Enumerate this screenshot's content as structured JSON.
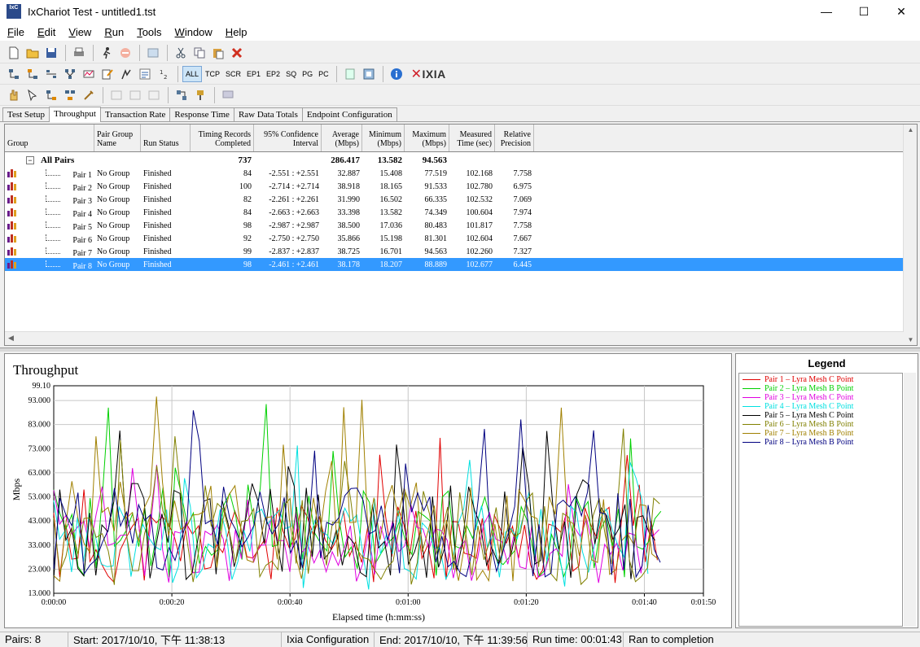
{
  "window": {
    "title": "IxChariot Test - untitled1.tst",
    "icon_text": "IxC",
    "minimize": "—",
    "maximize": "☐",
    "close": "✕"
  },
  "menu": [
    {
      "pre": "",
      "u": "F",
      "post": "ile"
    },
    {
      "pre": "",
      "u": "E",
      "post": "dit"
    },
    {
      "pre": "",
      "u": "V",
      "post": "iew"
    },
    {
      "pre": "",
      "u": "R",
      "post": "un"
    },
    {
      "pre": "",
      "u": "T",
      "post": "ools"
    },
    {
      "pre": "",
      "u": "W",
      "post": "indow"
    },
    {
      "pre": "",
      "u": "H",
      "post": "elp"
    }
  ],
  "toolbar2_text": [
    "ALL",
    "TCP",
    "SCR",
    "EP1",
    "EP2",
    "SQ",
    "PG",
    "PC"
  ],
  "ixia_logo": "IXIA",
  "tabs": [
    "Test Setup",
    "Throughput",
    "Transaction Rate",
    "Response Time",
    "Raw Data Totals",
    "Endpoint Configuration"
  ],
  "active_tab": "Throughput",
  "grid": {
    "headers": [
      [
        "",
        "Group"
      ],
      [
        "Pair Group",
        "Name"
      ],
      [
        "",
        "Run Status"
      ],
      [
        "Timing Records",
        "Completed"
      ],
      [
        "95% Confidence",
        "Interval"
      ],
      [
        "Average",
        "(Mbps)"
      ],
      [
        "Minimum",
        "(Mbps)"
      ],
      [
        "Maximum",
        "(Mbps)"
      ],
      [
        "Measured",
        "Time (sec)"
      ],
      [
        "Relative",
        "Precision"
      ]
    ],
    "total": {
      "label": "All Pairs",
      "expander": "−",
      "records": "737",
      "average": "286.417",
      "minimum": "13.582",
      "maximum": "94.563"
    },
    "rows": [
      {
        "pair": "Pair 1",
        "group": "No Group",
        "status": "Finished",
        "records": "84",
        "ci": "-2.551 : +2.551",
        "avg": "32.887",
        "min": "15.408",
        "max": "77.519",
        "time": "102.168",
        "prec": "7.758"
      },
      {
        "pair": "Pair 2",
        "group": "No Group",
        "status": "Finished",
        "records": "100",
        "ci": "-2.714 : +2.714",
        "avg": "38.918",
        "min": "18.165",
        "max": "91.533",
        "time": "102.780",
        "prec": "6.975"
      },
      {
        "pair": "Pair 3",
        "group": "No Group",
        "status": "Finished",
        "records": "82",
        "ci": "-2.261 : +2.261",
        "avg": "31.990",
        "min": "16.502",
        "max": "66.335",
        "time": "102.532",
        "prec": "7.069"
      },
      {
        "pair": "Pair 4",
        "group": "No Group",
        "status": "Finished",
        "records": "84",
        "ci": "-2.663 : +2.663",
        "avg": "33.398",
        "min": "13.582",
        "max": "74.349",
        "time": "100.604",
        "prec": "7.974"
      },
      {
        "pair": "Pair 5",
        "group": "No Group",
        "status": "Finished",
        "records": "98",
        "ci": "-2.987 : +2.987",
        "avg": "38.500",
        "min": "17.036",
        "max": "80.483",
        "time": "101.817",
        "prec": "7.758"
      },
      {
        "pair": "Pair 6",
        "group": "No Group",
        "status": "Finished",
        "records": "92",
        "ci": "-2.750 : +2.750",
        "avg": "35.866",
        "min": "15.198",
        "max": "81.301",
        "time": "102.604",
        "prec": "7.667"
      },
      {
        "pair": "Pair 7",
        "group": "No Group",
        "status": "Finished",
        "records": "99",
        "ci": "-2.837 : +2.837",
        "avg": "38.725",
        "min": "16.701",
        "max": "94.563",
        "time": "102.260",
        "prec": "7.327"
      },
      {
        "pair": "Pair 8",
        "group": "No Group",
        "status": "Finished",
        "records": "98",
        "ci": "-2.461 : +2.461",
        "avg": "38.178",
        "min": "18.207",
        "max": "88.889",
        "time": "102.677",
        "prec": "6.445"
      }
    ],
    "selected_row": 7
  },
  "legend": {
    "title": "Legend",
    "items": [
      {
        "label": "Pair 1 – Lyra Mesh C Point",
        "color": "#e00000"
      },
      {
        "label": "Pair 2 – Lyra Mesh B Point",
        "color": "#00d000"
      },
      {
        "label": "Pair 3 – Lyra Mesh C Point",
        "color": "#e000e0"
      },
      {
        "label": "Pair 4 – Lyra Mesh C Point",
        "color": "#00e0e0"
      },
      {
        "label": "Pair 5 – Lyra Mesh C Point",
        "color": "#000000"
      },
      {
        "label": "Pair 6 – Lyra Mesh B Point",
        "color": "#808000"
      },
      {
        "label": "Pair 7 – Lyra Mesh B Point",
        "color": "#a08000"
      },
      {
        "label": "Pair 8 – Lyra Mesh B Point",
        "color": "#000080"
      }
    ]
  },
  "chart_data": {
    "type": "line",
    "title": "Throughput",
    "xlabel": "Elapsed time (h:mm:ss)",
    "ylabel": "Mbps",
    "ylim": [
      13.0,
      99.1
    ],
    "y_ticks": [
      "99.10",
      "93.000",
      "83.000",
      "73.000",
      "63.000",
      "53.000",
      "43.000",
      "33.000",
      "23.000",
      "13.000"
    ],
    "y_tick_values": [
      99.1,
      93,
      83,
      73,
      63,
      53,
      43,
      33,
      23,
      13
    ],
    "xlim_seconds": [
      0,
      110
    ],
    "x_ticks": [
      "0:00:00",
      "0:00:20",
      "0:00:40",
      "0:01:00",
      "0:01:20",
      "0:01:40",
      "0:01:50"
    ],
    "x_tick_seconds": [
      0,
      20,
      40,
      60,
      80,
      100,
      110
    ],
    "grid": true,
    "series": [
      {
        "name": "Pair 1 – Lyra Mesh C Point",
        "color": "#e00000",
        "seed": 11,
        "avg": 32.9,
        "min": 15.4,
        "max": 77.5,
        "end": 102.2
      },
      {
        "name": "Pair 2 – Lyra Mesh B Point",
        "color": "#00d000",
        "seed": 23,
        "avg": 38.9,
        "min": 18.2,
        "max": 91.5,
        "end": 102.8
      },
      {
        "name": "Pair 3 – Lyra Mesh C Point",
        "color": "#e000e0",
        "seed": 37,
        "avg": 32.0,
        "min": 16.5,
        "max": 66.3,
        "end": 102.5
      },
      {
        "name": "Pair 4 – Lyra Mesh C Point",
        "color": "#00e0e0",
        "seed": 41,
        "avg": 33.4,
        "min": 13.6,
        "max": 74.3,
        "end": 100.6
      },
      {
        "name": "Pair 5 – Lyra Mesh C Point",
        "color": "#000000",
        "seed": 53,
        "avg": 38.5,
        "min": 17.0,
        "max": 80.5,
        "end": 101.8
      },
      {
        "name": "Pair 6 – Lyra Mesh B Point",
        "color": "#808000",
        "seed": 67,
        "avg": 35.9,
        "min": 15.2,
        "max": 81.3,
        "end": 102.6
      },
      {
        "name": "Pair 7 – Lyra Mesh B Point",
        "color": "#a08000",
        "seed": 71,
        "avg": 38.7,
        "min": 16.7,
        "max": 94.6,
        "end": 102.3
      },
      {
        "name": "Pair 8 – Lyra Mesh B Point",
        "color": "#000080",
        "seed": 89,
        "avg": 38.2,
        "min": 18.2,
        "max": 88.9,
        "end": 102.7
      }
    ]
  },
  "status": {
    "pairs": "Pairs: 8",
    "start": "Start: 2017/10/10, 下午 11:38:13",
    "config": "Ixia Configuration",
    "end": "End: 2017/10/10, 下午 11:39:56",
    "runtime": "Run time: 00:01:43",
    "result": "Ran to completion"
  }
}
